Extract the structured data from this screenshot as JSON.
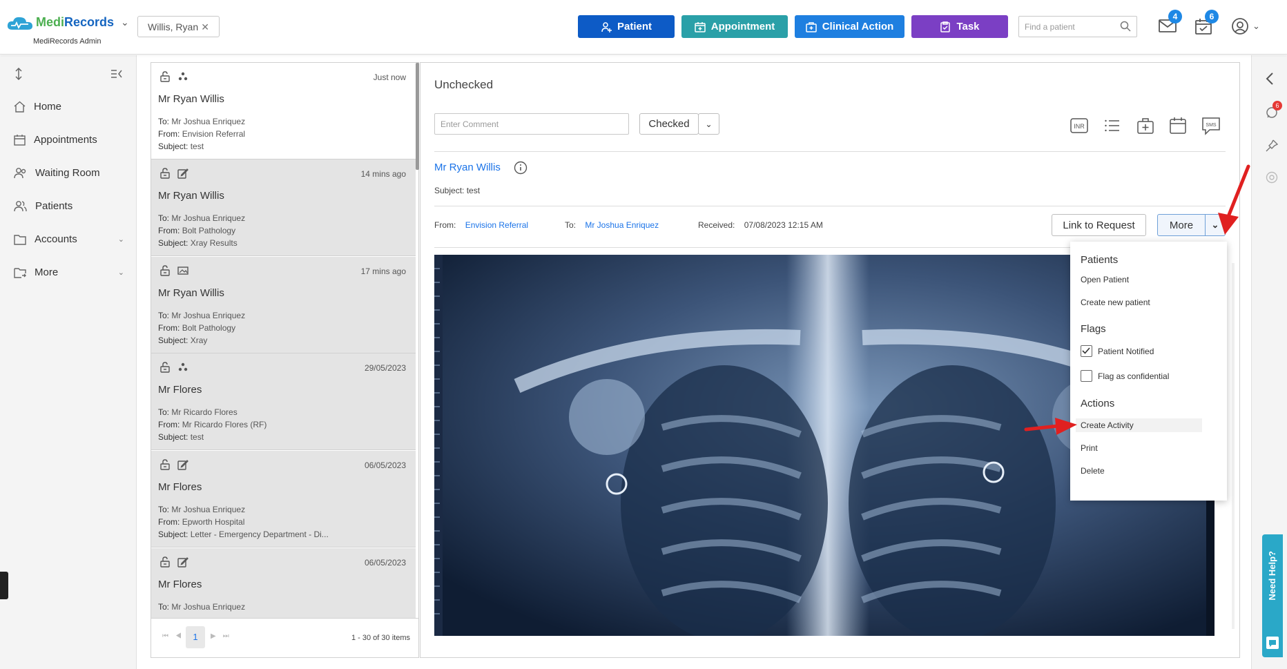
{
  "app": {
    "name_part1": "Medi",
    "name_part2": "Records",
    "subtitle": "MediRecords Admin"
  },
  "header": {
    "current_patient": "Willis, Ryan",
    "buttons": {
      "patient": "Patient",
      "appointment": "Appointment",
      "clinical_action": "Clinical Action",
      "task": "Task"
    },
    "search_placeholder": "Find a patient",
    "mail_count": "4",
    "tasks_count": "6"
  },
  "sidebar": {
    "items": [
      {
        "label": "Home"
      },
      {
        "label": "Appointments"
      },
      {
        "label": "Waiting Room"
      },
      {
        "label": "Patients"
      },
      {
        "label": "Accounts"
      },
      {
        "label": "More"
      }
    ]
  },
  "messages": [
    {
      "time": "Just now",
      "name": "Mr Ryan Willis",
      "to": "Mr Joshua Enriquez",
      "from": "Envision Referral",
      "subject": "test"
    },
    {
      "time": "14 mins ago",
      "name": "Mr Ryan Willis",
      "to": "Mr Joshua Enriquez",
      "from": "Bolt Pathology",
      "subject": "Xray Results"
    },
    {
      "time": "17 mins ago",
      "name": "Mr Ryan Willis",
      "to": "Mr Joshua Enriquez",
      "from": "Bolt Pathology",
      "subject": "Xray"
    },
    {
      "time": "29/05/2023",
      "name": "Mr Flores",
      "to": "Mr Ricardo Flores",
      "from": "Mr Ricardo Flores (RF)",
      "subject": "test"
    },
    {
      "time": "06/05/2023",
      "name": "Mr Flores",
      "to": "Mr Joshua Enriquez",
      "from": "Epworth Hospital",
      "subject": "Letter - Emergency Department - Di..."
    },
    {
      "time": "06/05/2023",
      "name": "Mr Flores",
      "to": "Mr Joshua Enriquez",
      "from": "",
      "subject": ""
    }
  ],
  "labels": {
    "to": "To:",
    "from": "From:",
    "subject": "Subject:",
    "received": "Received:"
  },
  "pager": {
    "current_page": "1",
    "summary": "1 - 30 of 30 items"
  },
  "detail": {
    "status": "Unchecked",
    "comment_placeholder": "Enter Comment",
    "checked_label": "Checked",
    "patient_name": "Mr Ryan Willis",
    "subject": "test",
    "from": "Envision Referral",
    "to": "Mr Joshua Enriquez",
    "received": "07/08/2023 12:15 AM",
    "link_to_request": "Link to Request",
    "more": "More",
    "tool_inr": "INR",
    "tool_sms": "SMS"
  },
  "more_menu": {
    "patients_heading": "Patients",
    "open_patient": "Open Patient",
    "create_new_patient": "Create new patient",
    "flags_heading": "Flags",
    "patient_notified": "Patient Notified",
    "patient_notified_checked": true,
    "flag_confidential": "Flag as confidential",
    "flag_confidential_checked": false,
    "actions_heading": "Actions",
    "create_activity": "Create Activity",
    "print": "Print",
    "delete": "Delete"
  },
  "right_rail": {
    "notification_count": "6",
    "need_help": "Need Help?"
  },
  "colors": {
    "patient_btn": "#0d5bc6",
    "appointment_btn": "#2aa0a8",
    "clinical_action_btn": "#1e7fe0",
    "task_btn": "#7b3fc4",
    "link_blue": "#1a73e8",
    "annotation_red": "#e02020"
  }
}
